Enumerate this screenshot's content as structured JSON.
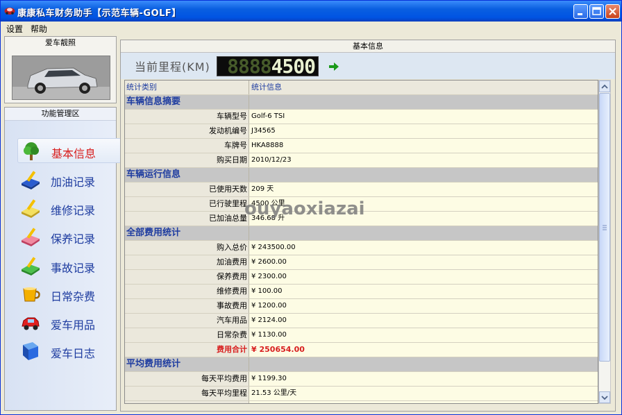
{
  "window": {
    "title": "康康私车财务助手【示范车辆-GOLF】"
  },
  "menu": [
    {
      "label": "设置"
    },
    {
      "label": "帮助"
    }
  ],
  "left": {
    "photo_header": "爱车靓照",
    "func_header": "功能管理区",
    "nav": [
      {
        "label": "基本信息",
        "icon": "tree-icon",
        "active": true
      },
      {
        "label": "加油记录",
        "icon": "notebook-pen-icon"
      },
      {
        "label": "维修记录",
        "icon": "notebook-pen-icon"
      },
      {
        "label": "保养记录",
        "icon": "notebook-pen-icon"
      },
      {
        "label": "事故记录",
        "icon": "notebook-pen-icon"
      },
      {
        "label": "日常杂费",
        "icon": "cup-icon"
      },
      {
        "label": "爱车用品",
        "icon": "toy-car-icon"
      },
      {
        "label": "爱车日志",
        "icon": "book-icon"
      }
    ]
  },
  "main": {
    "header": "基本信息",
    "mileage_label": "当前里程(KM)",
    "mileage_ghost": "8888",
    "mileage_value": "4500",
    "columns": [
      "统计类别",
      "统计信息"
    ],
    "rows": [
      {
        "type": "section",
        "label": "车辆信息摘要",
        "value": ""
      },
      {
        "type": "item",
        "label": "车辆型号",
        "value": "Golf-6 TSI"
      },
      {
        "type": "item",
        "label": "发动机编号",
        "value": "J34565"
      },
      {
        "type": "item",
        "label": "车牌号",
        "value": "HKA8888"
      },
      {
        "type": "item",
        "label": "购买日期",
        "value": "2010/12/23"
      },
      {
        "type": "section",
        "label": "车辆运行信息",
        "value": ""
      },
      {
        "type": "item",
        "label": "已使用天数",
        "value": "209 天"
      },
      {
        "type": "item",
        "label": "已行驶里程",
        "value": "4500 公里"
      },
      {
        "type": "item",
        "label": "已加油总量",
        "value": "346.68 升"
      },
      {
        "type": "section",
        "label": "全部费用统计",
        "value": ""
      },
      {
        "type": "item",
        "label": "购入总价",
        "value": "¥ 243500.00"
      },
      {
        "type": "item",
        "label": "加油费用",
        "value": "¥ 2600.00"
      },
      {
        "type": "item",
        "label": "保养费用",
        "value": "¥ 2300.00"
      },
      {
        "type": "item",
        "label": "维修费用",
        "value": "¥ 100.00"
      },
      {
        "type": "item",
        "label": "事故费用",
        "value": "¥ 1200.00"
      },
      {
        "type": "item",
        "label": "汽车用品",
        "value": "¥ 2124.00"
      },
      {
        "type": "item",
        "label": "日常杂费",
        "value": "¥ 1130.00"
      },
      {
        "type": "total",
        "label": "费用合计",
        "value": "¥ 250654.00"
      },
      {
        "type": "section",
        "label": "平均费用统计",
        "value": ""
      },
      {
        "type": "item",
        "label": "每天平均费用",
        "value": "¥ 1199.30"
      },
      {
        "type": "item",
        "label": "每天平均里程",
        "value": "21.53 公里/天"
      },
      {
        "type": "item",
        "label": "",
        "value": ""
      }
    ]
  },
  "watermark": "ouyaoxiazai",
  "colors": {
    "accent_red": "#d81e1e",
    "label_blue": "#1e3ca0",
    "grid_bg": "#fdfce4",
    "section_bg": "#c6c6c6",
    "titlebar": "#0054e3"
  }
}
